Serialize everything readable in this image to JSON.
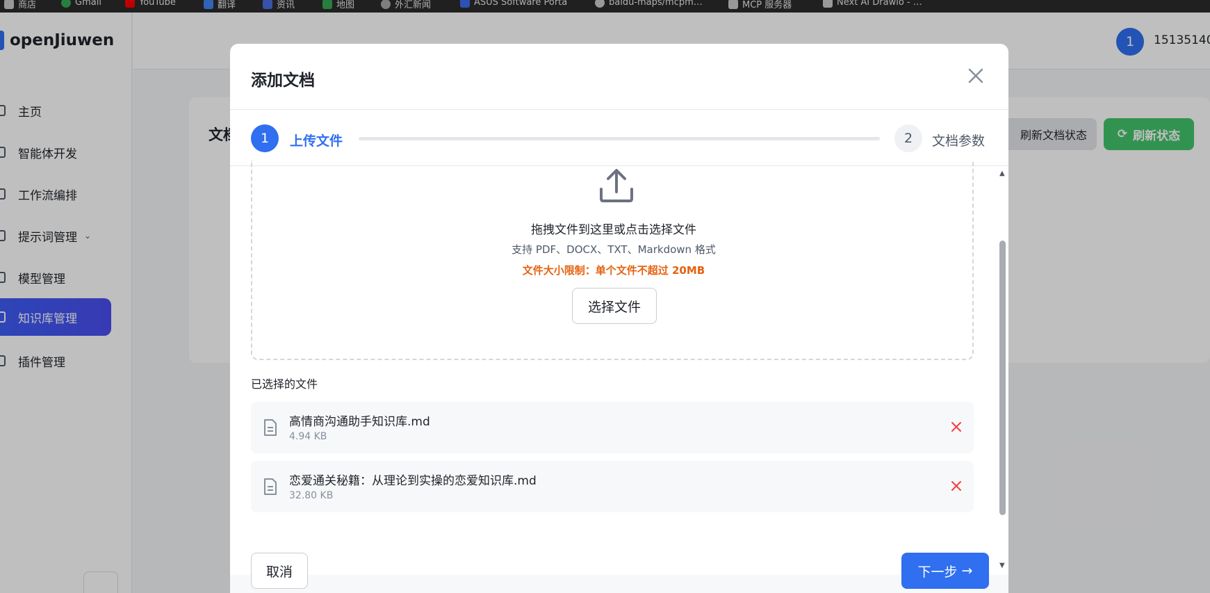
{
  "browser": {
    "bookmarks": [
      {
        "label": "商店",
        "color": "#cccccc"
      },
      {
        "label": "Gmail",
        "color": "#34a853"
      },
      {
        "label": "YouTube",
        "color": "#ff0000"
      },
      {
        "label": "翻译",
        "color": "#4285f4"
      },
      {
        "label": "资讯",
        "color": "#4a6ee0"
      },
      {
        "label": "地图",
        "color": "#34a853"
      },
      {
        "label": "外汇新闻",
        "color": "#aaaaaa"
      },
      {
        "label": "ASUS Software Porta",
        "color": "#3d6ef0"
      },
      {
        "label": "baidu-maps/mcpm…",
        "color": "#cccccc"
      },
      {
        "label": "MCP 服务器",
        "color": "#cccccc"
      },
      {
        "label": "Next AI Drawio - …",
        "color": "#cccccc"
      }
    ]
  },
  "app": {
    "logo_text": "openJiuwen",
    "user": {
      "avatar_text": "1",
      "name": "15135140"
    },
    "sidebar": {
      "items": [
        {
          "label": "主页",
          "icon": "home-icon"
        },
        {
          "label": "智能体开发",
          "icon": "agent-icon"
        },
        {
          "label": "工作流编排",
          "icon": "workflow-icon"
        },
        {
          "label": "提示词管理",
          "icon": "prompt-icon",
          "has_submenu": true
        },
        {
          "label": "模型管理",
          "icon": "model-icon"
        },
        {
          "label": "知识库管理",
          "icon": "database-icon",
          "active": true
        },
        {
          "label": "插件管理",
          "icon": "plugin-icon"
        }
      ]
    },
    "content": {
      "title_partial": "文档",
      "refresh_docs_label": "刷新文档状态",
      "refresh_status_label": "刷新状态"
    }
  },
  "modal": {
    "title": "添加文档",
    "steps": [
      {
        "number": "1",
        "label": "上传文件",
        "active": true
      },
      {
        "number": "2",
        "label": "文档参数",
        "active": false
      }
    ],
    "dropzone": {
      "main_text": "拖拽文件到这里或点击选择文件",
      "formats_text": "支持 PDF、DOCX、TXT、Markdown 格式",
      "limit_text": "文件大小限制：单个文件不超过 20MB",
      "select_button": "选择文件"
    },
    "selected_title": "已选择的文件",
    "files": [
      {
        "name": "高情商沟通助手知识库.md",
        "size": "4.94 KB"
      },
      {
        "name": "恋爱通关秘籍：从理论到实操的恋爱知识库.md",
        "size": "32.80 KB"
      }
    ],
    "cancel_label": "取消",
    "next_label": "下一步",
    "colors": {
      "primary": "#2f6ff0",
      "warning": "#e5620f",
      "danger": "#f53f3f",
      "success": "#43c46b"
    }
  }
}
